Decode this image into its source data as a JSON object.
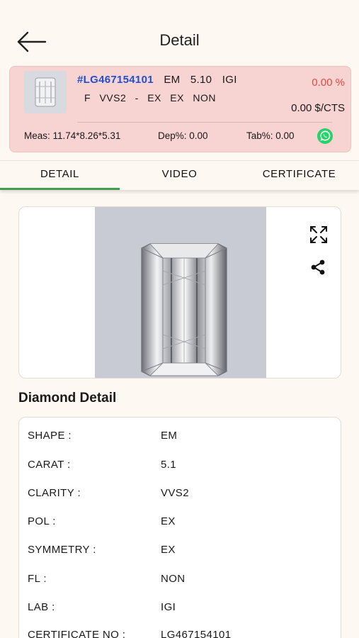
{
  "header": {
    "title": "Detail"
  },
  "summary": {
    "stock_id": "#LG467154101",
    "shape": "EM",
    "carat": "5.10",
    "lab": "IGI",
    "color": "F",
    "clarity": "VVS2",
    "dash": "-",
    "cut": "EX",
    "polish": "EX",
    "fluorescence": "NON",
    "discount": "0.00 %",
    "price": "0.00 $/CTS",
    "meas": "Meas: 11.74*8.26*5.31",
    "depth": "Dep%: 0.00",
    "table": "Tab%: 0.00"
  },
  "tabs": [
    {
      "label": "DETAIL"
    },
    {
      "label": "VIDEO"
    },
    {
      "label": "CERTIFICATE"
    }
  ],
  "section_title": "Diamond Detail",
  "details": [
    {
      "key": "SHAPE :",
      "value": "EM"
    },
    {
      "key": "CARAT :",
      "value": "5.1"
    },
    {
      "key": "CLARITY :",
      "value": "VVS2"
    },
    {
      "key": "POL :",
      "value": "EX"
    },
    {
      "key": "SYMMETRY :",
      "value": "EX"
    },
    {
      "key": "FL :",
      "value": "NON"
    },
    {
      "key": "LAB :",
      "value": "IGI"
    },
    {
      "key": "CERTIFICATE NO :",
      "value": "LG467154101"
    }
  ],
  "colors": {
    "accent_green": "#3f9f4a",
    "card_pink": "#f7d3d1",
    "stock_blue": "#1f4fd6",
    "discount_red": "#e34a3c",
    "whatsapp_green": "#25d366"
  },
  "icons": [
    "back-arrow-icon",
    "whatsapp-icon",
    "expand-icon",
    "share-icon"
  ]
}
